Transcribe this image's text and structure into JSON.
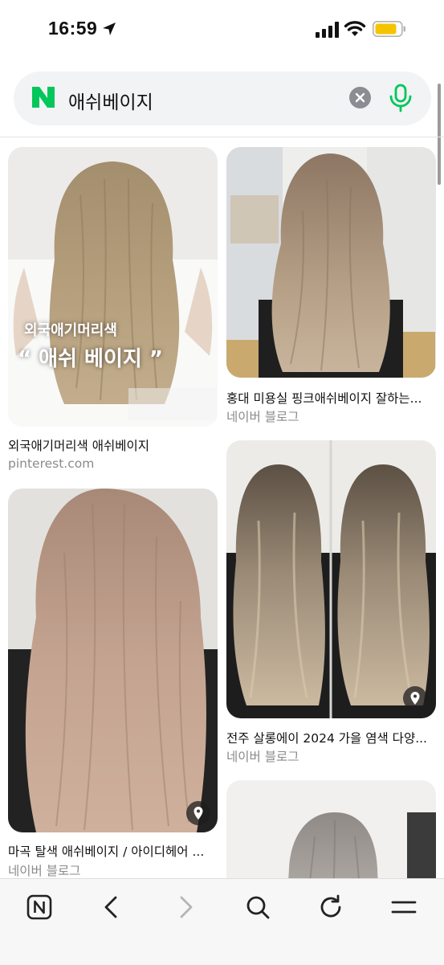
{
  "status_bar": {
    "time": "16:59"
  },
  "search": {
    "query": "애쉬베이지",
    "brand_icon": "naver-n-logo",
    "accent": "#03c75a"
  },
  "results": [
    {
      "title": "외국애기머리색 애쉬베이지",
      "source": "pinterest.com",
      "overlay_line1": "외국애기머리색",
      "overlay_line2": "“ 애쉬 베이지 ”"
    },
    {
      "title": "홍대 미용실 핑크애쉬베이지 잘하는...",
      "source": "네이버 블로그"
    },
    {
      "title": "마곡 탈색 애쉬베이지 / 아이디헤어 ...",
      "source": "네이버 블로그"
    },
    {
      "title": "전주 살롱에이 2024 가을 염색 다양...",
      "source": "네이버 블로그"
    },
    {
      "title": "",
      "source": ""
    }
  ],
  "toolbar": {
    "items": [
      "naver-home-icon",
      "back-icon",
      "forward-icon",
      "search-icon",
      "refresh-icon",
      "menu-icon"
    ]
  }
}
